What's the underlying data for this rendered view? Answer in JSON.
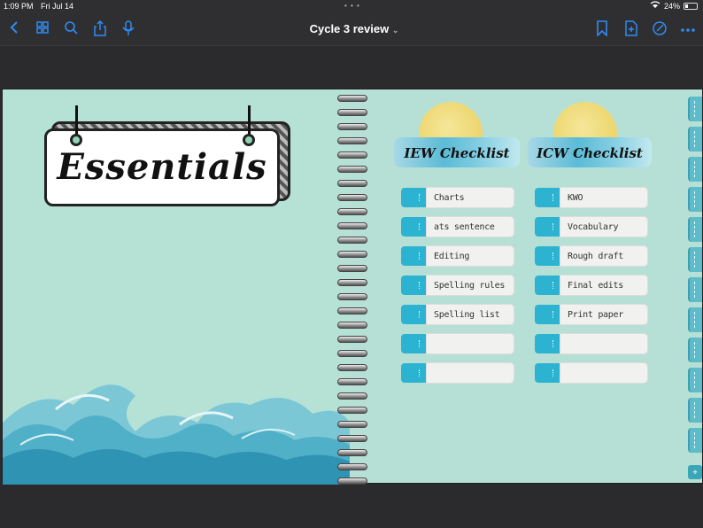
{
  "status_bar": {
    "time": "1:09 PM",
    "date": "Fri Jul 14",
    "multitask_dots": "• • •",
    "battery": "24%"
  },
  "toolbar": {
    "title": "Cycle 3 review",
    "title_chevron": "⌄",
    "accent_color": "#2e8bf5",
    "icons": [
      "back-icon",
      "grid-icon",
      "search-icon",
      "share-icon",
      "mic-icon",
      "bookmark-icon",
      "add-page-icon",
      "annotate-icon",
      "more-icon"
    ]
  },
  "page": {
    "sign_title": "Essentials",
    "iew_header": "IEW Checklist",
    "iew_items": [
      "Charts",
      "ats sentence",
      "Editing",
      "Spelling rules",
      "Spelling list",
      "",
      ""
    ],
    "cl_header": "ICW Checklist",
    "cl_items": [
      "KWO",
      "Vocabulary",
      "Rough draft",
      "Final edits",
      "Print paper",
      "",
      ""
    ],
    "colors": {
      "page_bg": "#b6e2d6",
      "tab_color": "#2cb3d1",
      "sun": "#f2dc7a"
    }
  }
}
